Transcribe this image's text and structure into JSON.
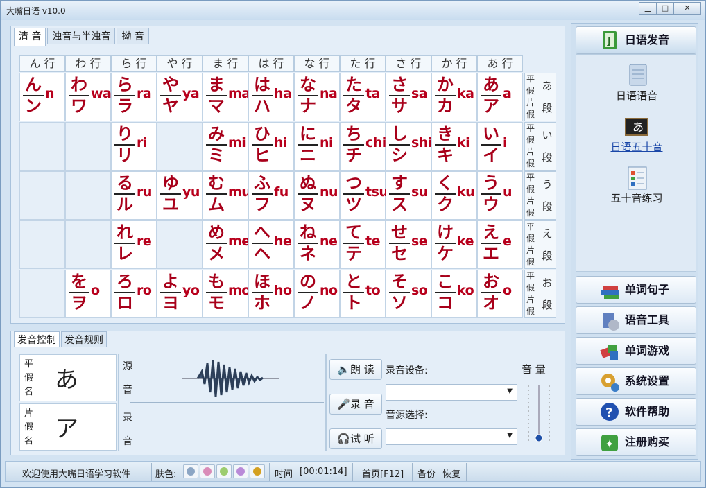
{
  "window": {
    "title": "大嘴日语 v10.0"
  },
  "tabs": [
    "清  音",
    "浊音与半浊音",
    "拗  音"
  ],
  "grid": {
    "headers": [
      "ん 行",
      "わ 行",
      "ら 行",
      "や 行",
      "ま 行",
      "は 行",
      "な 行",
      "た 行",
      "さ 行",
      "か 行",
      "あ 行"
    ],
    "rows": [
      [
        {
          "h": "ん",
          "k": "ン",
          "r": "n"
        },
        {
          "h": "わ",
          "k": "ワ",
          "r": "wa"
        },
        {
          "h": "ら",
          "k": "ラ",
          "r": "ra"
        },
        {
          "h": "や",
          "k": "ヤ",
          "r": "ya"
        },
        {
          "h": "ま",
          "k": "マ",
          "r": "ma"
        },
        {
          "h": "は",
          "k": "ハ",
          "r": "ha"
        },
        {
          "h": "な",
          "k": "ナ",
          "r": "na"
        },
        {
          "h": "た",
          "k": "タ",
          "r": "ta"
        },
        {
          "h": "さ",
          "k": "サ",
          "r": "sa"
        },
        {
          "h": "か",
          "k": "カ",
          "r": "ka"
        },
        {
          "h": "あ",
          "k": "ア",
          "r": "a"
        }
      ],
      [
        null,
        null,
        {
          "h": "り",
          "k": "リ",
          "r": "ri"
        },
        null,
        {
          "h": "み",
          "k": "ミ",
          "r": "mi"
        },
        {
          "h": "ひ",
          "k": "ヒ",
          "r": "hi"
        },
        {
          "h": "に",
          "k": "ニ",
          "r": "ni"
        },
        {
          "h": "ち",
          "k": "チ",
          "r": "chi"
        },
        {
          "h": "し",
          "k": "シ",
          "r": "shi"
        },
        {
          "h": "き",
          "k": "キ",
          "r": "ki"
        },
        {
          "h": "い",
          "k": "イ",
          "r": "i"
        }
      ],
      [
        null,
        null,
        {
          "h": "る",
          "k": "ル",
          "r": "ru"
        },
        {
          "h": "ゆ",
          "k": "ユ",
          "r": "yu"
        },
        {
          "h": "む",
          "k": "ム",
          "r": "mu"
        },
        {
          "h": "ふ",
          "k": "フ",
          "r": "fu"
        },
        {
          "h": "ぬ",
          "k": "ヌ",
          "r": "nu"
        },
        {
          "h": "つ",
          "k": "ツ",
          "r": "tsu"
        },
        {
          "h": "す",
          "k": "ス",
          "r": "su"
        },
        {
          "h": "く",
          "k": "ク",
          "r": "ku"
        },
        {
          "h": "う",
          "k": "ウ",
          "r": "u"
        }
      ],
      [
        null,
        null,
        {
          "h": "れ",
          "k": "レ",
          "r": "re"
        },
        null,
        {
          "h": "め",
          "k": "メ",
          "r": "me"
        },
        {
          "h": "へ",
          "k": "ヘ",
          "r": "he"
        },
        {
          "h": "ね",
          "k": "ネ",
          "r": "ne"
        },
        {
          "h": "て",
          "k": "テ",
          "r": "te"
        },
        {
          "h": "せ",
          "k": "セ",
          "r": "se"
        },
        {
          "h": "け",
          "k": "ケ",
          "r": "ke"
        },
        {
          "h": "え",
          "k": "エ",
          "r": "e"
        }
      ],
      [
        null,
        {
          "h": "を",
          "k": "ヲ",
          "r": "o"
        },
        {
          "h": "ろ",
          "k": "ロ",
          "r": "ro"
        },
        {
          "h": "よ",
          "k": "ヨ",
          "r": "yo"
        },
        {
          "h": "も",
          "k": "モ",
          "r": "mo"
        },
        {
          "h": "ほ",
          "k": "ホ",
          "r": "ho"
        },
        {
          "h": "の",
          "k": "ノ",
          "r": "no"
        },
        {
          "h": "と",
          "k": "ト",
          "r": "to"
        },
        {
          "h": "そ",
          "k": "ソ",
          "r": "so"
        },
        {
          "h": "こ",
          "k": "コ",
          "r": "ko"
        },
        {
          "h": "お",
          "k": "オ",
          "r": "o"
        }
      ]
    ],
    "sidelabels": [
      {
        "l1": "平假",
        "l2": "片假",
        "seg": "あ",
        "seg2": "段"
      },
      {
        "l1": "平假",
        "l2": "片假",
        "seg": "い",
        "seg2": "段"
      },
      {
        "l1": "平假",
        "l2": "片假",
        "seg": "う",
        "seg2": "段"
      },
      {
        "l1": "平假",
        "l2": "片假",
        "seg": "え",
        "seg2": "段"
      },
      {
        "l1": "平假",
        "l2": "片假",
        "seg": "お",
        "seg2": "段"
      }
    ]
  },
  "control": {
    "tabs": [
      "发音控制",
      "发音规则"
    ],
    "hira_label": "平假名",
    "hira_char": "あ",
    "kata_label": "片假名",
    "kata_char": "ア",
    "source_label": "源音",
    "record_label": "录音",
    "read_button": "朗 读",
    "record_button": "录 音",
    "listen_button": "试 听",
    "record_device_label": "录音设备:",
    "source_select_label": "音源选择:",
    "volume_label": "音 量",
    "volume_level": 0.05
  },
  "sidebar": {
    "active_button": "日语发音",
    "panel_items": [
      "日语语音",
      "日语五十音",
      "五十音练习"
    ],
    "buttons": [
      "单词句子",
      "语音工具",
      "单词游戏",
      "系统设置",
      "软件帮助",
      "注册购买"
    ]
  },
  "status": {
    "welcome": "欢迎使用大嘴日语学习软件",
    "skin_label": "肤色:",
    "skin_colors": [
      "#8ca6c4",
      "#d98cb8",
      "#9ccc6e",
      "#b98ad8",
      "#d4a020"
    ],
    "time_label": "时间",
    "time_value": "[00:01:14]",
    "home": "首页[F12]",
    "backup": "备份",
    "restore": "恢复"
  }
}
